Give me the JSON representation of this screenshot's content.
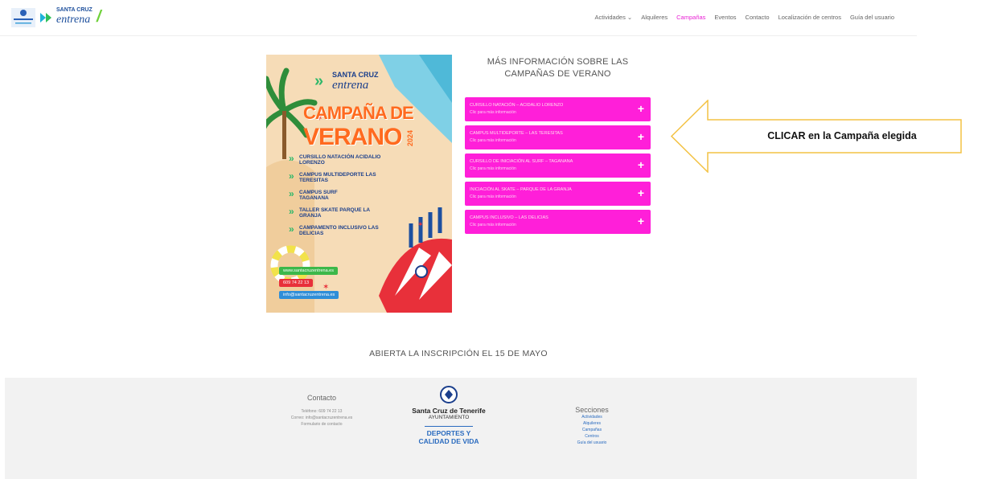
{
  "header": {
    "logo_text_line1": "SANTA CRUZ",
    "logo_text_line2": "entrena",
    "nav": [
      {
        "label": "Actividades ⌄",
        "active": false
      },
      {
        "label": "Alquileres",
        "active": false
      },
      {
        "label": "Campañas",
        "active": true
      },
      {
        "label": "Eventos",
        "active": false
      },
      {
        "label": "Contacto",
        "active": false
      },
      {
        "label": "Localización de centros",
        "active": false
      },
      {
        "label": "Guía del usuario",
        "active": false
      }
    ]
  },
  "poster": {
    "brand1": "SANTA CRUZ",
    "brand2": "entrena",
    "title1": "CAMPAÑA DE",
    "title2": "VERANO",
    "year": "2024",
    "items": [
      "CURSILLO NATACIÓN ACIDALIO LORENZO",
      "CAMPUS MULTIDEPORTE LAS TERESITAS",
      "CAMPUS SURF TAGANANA",
      "TALLER SKATE PARQUE LA GRANJA",
      "CAMPAMENTO INCLUSIVO LAS DELICIAS"
    ],
    "web": "www.santacruzentrena.es",
    "phone": "609 74 22 13",
    "email": "info@santacruzentrena.es"
  },
  "info": {
    "title": "MÁS INFORMACIÓN SOBRE LAS CAMPAÑAS DE VERANO",
    "subtitle": "Clic para más información",
    "items": [
      {
        "title": "CURSILLO NATACIÓN – ACIDALIO LORENZO"
      },
      {
        "title": "CAMPUS MULTIDEPORTE – LAS TERESITAS"
      },
      {
        "title": "CURSILLO DE INICIACIÓN AL SURF – TAGANANA"
      },
      {
        "title": "INICIACIÓN AL SKATE – PARQUE DE LA GRANJA"
      },
      {
        "title": "CAMPUS INCLUSIVO – LAS DELICIAS"
      }
    ]
  },
  "callout": "CLICAR en la Campaña elegida",
  "inscripcion": "ABIERTA LA INSCRIPCIÓN EL 15 DE MAYO",
  "footer": {
    "contact_title": "Contacto",
    "phone": "Teléfono: 609 74 22 13",
    "email": "Correo: info@santacruzentrena.es",
    "form": "Formulario de contacto",
    "org1": "Santa Cruz de Tenerife",
    "org2": "AYUNTAMIENTO",
    "org3": "DEPORTES Y",
    "org4": "CALIDAD DE VIDA",
    "sections_title": "Secciones",
    "sections": [
      "Actividades",
      "Alquileres",
      "Campañas",
      "Centros",
      "Guía del usuario"
    ]
  },
  "colors": {
    "accent": "#ff1fd9",
    "nav_active": "#e81fd4"
  }
}
